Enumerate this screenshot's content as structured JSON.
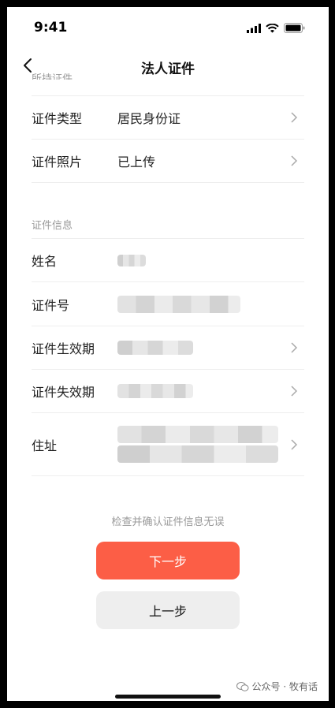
{
  "status_bar": {
    "time": "9:41"
  },
  "nav": {
    "title": "法人证件",
    "back_icon": "chevron-left-icon"
  },
  "sections": {
    "held_docs_label": "所持证件",
    "info_label": "证件信息"
  },
  "rows": {
    "id_type": {
      "label": "证件类型",
      "value": "居民身份证"
    },
    "id_photo": {
      "label": "证件照片",
      "value": "已上传"
    },
    "name": {
      "label": "姓名"
    },
    "id_number": {
      "label": "证件号"
    },
    "valid_from": {
      "label": "证件生效期"
    },
    "valid_to": {
      "label": "证件失效期"
    },
    "address": {
      "label": "住址"
    }
  },
  "hint": "检查并确认证件信息无误",
  "buttons": {
    "next": "下一步",
    "prev": "上一步"
  },
  "watermark": "公众号 · 牧有话"
}
